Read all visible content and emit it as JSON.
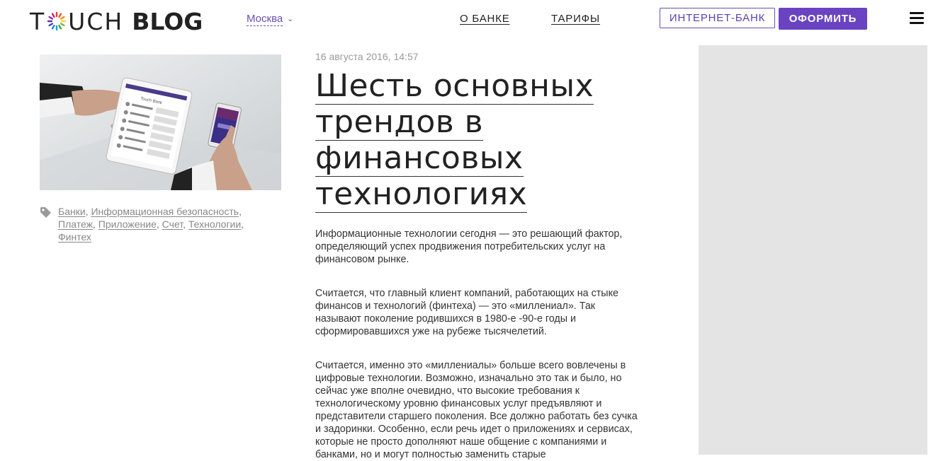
{
  "header": {
    "logo_text_1": "T",
    "logo_text_2": "UCH",
    "logo_text_bold": "BLOG",
    "city": "Москва",
    "nav": [
      {
        "label": "О БАНКЕ"
      },
      {
        "label": "ТАРИФЫ"
      }
    ],
    "internet_bank_label": "ИНТЕРНЕТ-БАНК",
    "apply_label": "ОФОРМИТЬ",
    "accent_color": "#6a43c2"
  },
  "sidebar": {
    "image_caption": "Touch Bank",
    "tags": [
      {
        "label": "Банки"
      },
      {
        "label": "Информационная безопасность"
      },
      {
        "label": "Платеж"
      },
      {
        "label": "Приложение"
      },
      {
        "label": "Счет"
      },
      {
        "label": "Технологии"
      },
      {
        "label": "Финтех"
      }
    ]
  },
  "article": {
    "date": "16 августа 2016, 14:57",
    "title_lines": [
      "Шесть основных",
      "трендов в",
      "финансовых",
      "технологиях"
    ],
    "paragraphs": [
      "Информационные технологии сегодня — это решающий фактор, определяющий успех продвижения потребительских услуг на финансовом рынке.",
      "Считается, что главный клиент компаний, работающих на стыке финансов и технологий (финтеха) — это «миллениал». Так называют поколение родившихся в 1980-е -90-е годы и сформировавшихся уже на рубеже тысячелетий.",
      "Считается, именно это «миллениалы» больше всего вовлечены в цифровые технологии. Возможно, изначально это так и было, но сейчас уже вполне очевидно, что высокие требования к технологическому уровню финансовых услуг предъявляют и представители старшего поколения. Все должно работать без сучка и задоринки. Особенно, если речь идет о приложениях и сервисах, которые не просто дополняют наше общение с компаниями и банками, но и могут полностью заменить старые"
    ]
  }
}
